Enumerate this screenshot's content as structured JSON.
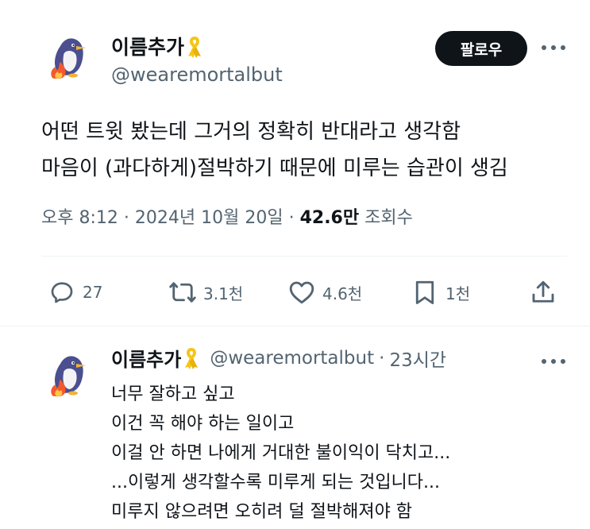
{
  "main_tweet": {
    "author": {
      "display_name": "이름추가",
      "handle": "@wearemortalbut",
      "badge_icon": "yellow-ribbon-icon",
      "avatar_icon": "penguin-fire-avatar"
    },
    "follow_label": "팔로우",
    "text_lines": [
      "어떤 트윗 봤는데 그거의 정확히 반대라고 생각함",
      "마음이 (과다하게)절박하기 때문에 미루는 습관이 생김"
    ],
    "meta": {
      "time": "오후 8:12",
      "dot1": "·",
      "date": "2024년 10월 20일",
      "dot2": "·",
      "views_count": "42.6만",
      "views_label": "조회수"
    },
    "actions": {
      "replies": "27",
      "retweets": "3.1천",
      "likes": "4.6천",
      "bookmarks": "1천"
    }
  },
  "reply_tweet": {
    "author": {
      "display_name": "이름추가",
      "handle": "@wearemortalbut",
      "separator": "·",
      "time": "23시간",
      "badge_icon": "yellow-ribbon-icon"
    },
    "text_lines": [
      "너무 잘하고 싶고",
      "이건 꼭 해야 하는 일이고",
      "이걸 안 하면 나에게 거대한 불이익이 닥치고...",
      "...이렇게 생각할수록 미루게 되는 것입니다...",
      "미루지 않으려면 오히려 덜 절박해져야 함"
    ]
  },
  "colors": {
    "text": "#0f1419",
    "secondary": "#536471",
    "divider": "#eff3f4",
    "ribbon": "#f5c518",
    "follow_bg": "#0f1419"
  }
}
